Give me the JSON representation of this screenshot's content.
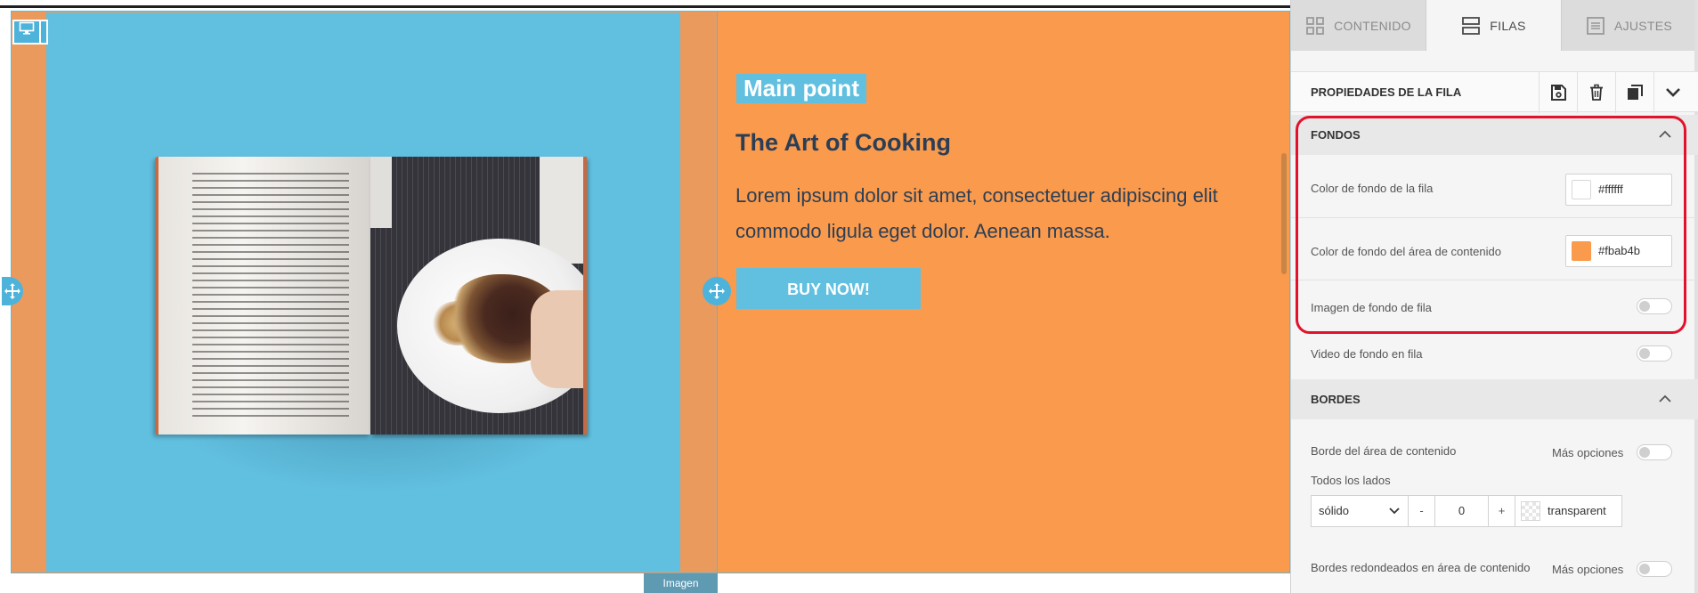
{
  "canvas": {
    "image_label": "Imagen",
    "heading_badge": "Main point",
    "title": "The Art of Cooking",
    "body_line1": "Lorem ipsum dolor sit amet, consectetuer adipiscing elit",
    "body_line2": "commodo ligula eget dolor. Aenean massa.",
    "cta_label": "BUY NOW!",
    "icons": {
      "device": "desktop-icon",
      "move": "move-arrows-icon"
    }
  },
  "panel": {
    "tabs": [
      {
        "label": "CONTENIDO",
        "icon": "grid-icon",
        "active": false
      },
      {
        "label": "FILAS",
        "icon": "rows-icon",
        "active": true
      },
      {
        "label": "AJUSTES",
        "icon": "settings-list-icon",
        "active": false
      }
    ],
    "props_title": "PROPIEDADES DE LA FILA",
    "header_icons": [
      "save-icon",
      "trash-icon",
      "duplicate-icon",
      "chevron-down-icon"
    ],
    "fondos": {
      "title": "FONDOS",
      "row_bg_label": "Color de fondo de la fila",
      "row_bg_value": "#ffffff",
      "content_bg_label": "Color de fondo del área de contenido",
      "content_bg_value": "#fbab4b",
      "content_bg_swatch": "#f99a4c",
      "row_image_label": "Imagen de fondo de fila",
      "row_video_label": "Video de fondo en fila"
    },
    "bordes": {
      "title": "BORDES",
      "content_border_label": "Borde del área de contenido",
      "more_options": "Más opciones",
      "all_sides_label": "Todos los lados",
      "style_value": "sólido",
      "minus": "-",
      "width_value": "0",
      "plus": "+",
      "color_value": "transparent",
      "rounded_label": "Bordes redondeados en área de contenido",
      "more_options2": "Más opciones"
    }
  },
  "colors": {
    "accent_blue": "#61bfdf",
    "row_orange": "#f99a4c",
    "highlight_red": "#e3122c",
    "title_navy": "#2c3e55"
  }
}
